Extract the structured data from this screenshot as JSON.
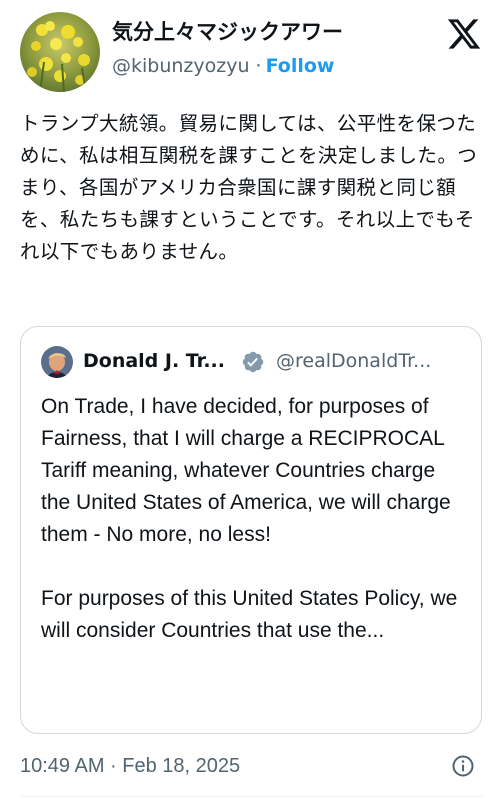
{
  "author": {
    "display_name": "気分上々マジックアワー",
    "handle": "@kibunzyozyu",
    "separator": "·",
    "follow_label": "Follow"
  },
  "platform": {
    "logo": "x-logo-icon"
  },
  "tweet": {
    "text": "トランプ大統領。貿易に関しては、公平性を保つために、私は相互関税を課すことを決定しました。つまり、各国がアメリカ合衆国に課す関税と同じ額を、私たちも課すということです。それ以上でもそれ以下でもありません。"
  },
  "quote": {
    "name": "Donald J. Tr...",
    "handle": "@realDonaldTr...",
    "verified_icon": "verified-badge-icon",
    "paragraph1": "On Trade, I have decided, for purposes of Fairness, that I will charge a RECIPROCAL Tariff meaning, whatever Countries charge the United States of America, we will charge them - No more, no less!",
    "paragraph2": "For purposes of this United States Policy, we will consider Countries that use the..."
  },
  "footer": {
    "timestamp": "10:49 AM · Feb 18, 2025",
    "info_icon": "info-icon"
  },
  "colors": {
    "text": "#0f1419",
    "secondary": "#536471",
    "accent": "#1d9bf0",
    "border": "#cfd9de",
    "verified": "#829aab"
  }
}
